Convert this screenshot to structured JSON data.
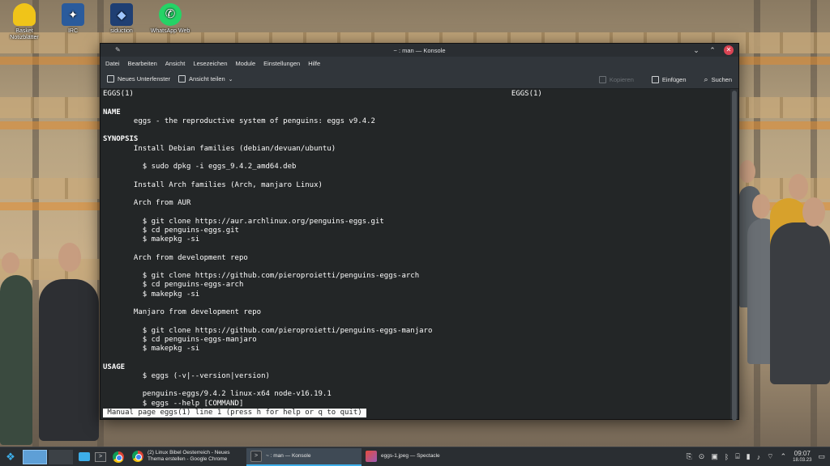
{
  "desktop": {
    "icons": [
      {
        "label": "Basket Notizblätter",
        "icon": "basket-icon"
      },
      {
        "label": "IRC",
        "icon": "irc-icon"
      },
      {
        "label": "siduction",
        "icon": "siduction-icon"
      },
      {
        "label": "WhatsApp Web",
        "icon": "whatsapp-icon"
      }
    ]
  },
  "window": {
    "title": "~ : man — Konsole",
    "menu": [
      "Datei",
      "Bearbeiten",
      "Ansicht",
      "Lesezeichen",
      "Module",
      "Einstellungen",
      "Hilfe"
    ],
    "toolbar": {
      "new_tab": "Neues Unterfenster",
      "split_view": "Ansicht teilen",
      "copy": "Kopieren",
      "paste": "Einfügen",
      "search": "Suchen"
    }
  },
  "terminal": {
    "lines": [
      {
        "text": "EGGS(1)                                                                                      EGGS(1)",
        "bold": false
      },
      {
        "text": "",
        "bold": false
      },
      {
        "text": "NAME",
        "bold": true
      },
      {
        "text": "       eggs - the reproductive system of penguins: eggs v9.4.2",
        "bold": false
      },
      {
        "text": "",
        "bold": false
      },
      {
        "text": "SYNOPSIS",
        "bold": true
      },
      {
        "text": "       Install Debian families (debian/devuan/ubuntu)",
        "bold": false
      },
      {
        "text": "",
        "bold": false
      },
      {
        "text": "         $ sudo dpkg -i eggs_9.4.2_amd64.deb",
        "bold": false
      },
      {
        "text": "",
        "bold": false
      },
      {
        "text": "       Install Arch families (Arch, manjaro Linux)",
        "bold": false
      },
      {
        "text": "",
        "bold": false
      },
      {
        "text": "       Arch from AUR",
        "bold": false
      },
      {
        "text": "",
        "bold": false
      },
      {
        "text": "         $ git clone https://aur.archlinux.org/penguins-eggs.git",
        "bold": false
      },
      {
        "text": "         $ cd penguins-eggs.git",
        "bold": false
      },
      {
        "text": "         $ makepkg -si",
        "bold": false
      },
      {
        "text": "",
        "bold": false
      },
      {
        "text": "       Arch from development repo",
        "bold": false
      },
      {
        "text": "",
        "bold": false
      },
      {
        "text": "         $ git clone https://github.com/pieroproietti/penguins-eggs-arch",
        "bold": false
      },
      {
        "text": "         $ cd penguins-eggs-arch",
        "bold": false
      },
      {
        "text": "         $ makepkg -si",
        "bold": false
      },
      {
        "text": "",
        "bold": false
      },
      {
        "text": "       Manjaro from development repo",
        "bold": false
      },
      {
        "text": "",
        "bold": false
      },
      {
        "text": "         $ git clone https://github.com/pieroproietti/penguins-eggs-manjaro",
        "bold": false
      },
      {
        "text": "         $ cd penguins-eggs-manjaro",
        "bold": false
      },
      {
        "text": "         $ makepkg -si",
        "bold": false
      },
      {
        "text": "",
        "bold": false
      },
      {
        "text": "USAGE",
        "bold": true
      },
      {
        "text": "         $ eggs (-v|--version|version)",
        "bold": false
      },
      {
        "text": "",
        "bold": false
      },
      {
        "text": "         penguins-eggs/9.4.2 linux-x64 node-v16.19.1",
        "bold": false
      },
      {
        "text": "         $ eggs --help [COMMAND]",
        "bold": false
      }
    ],
    "status": " Manual page eggs(1) line 1 (press h for help or q to quit) "
  },
  "taskbar": {
    "tasks": [
      {
        "label": "(2) Linux Bibel Oesterreich - Neues Thema erstellen - Google Chrome",
        "icon": "chrome-icon",
        "active": false
      },
      {
        "label": "~ : man — Konsole",
        "icon": "konsole-icon",
        "active": true
      },
      {
        "label": "eggs-1.jpeg — Spectacle",
        "icon": "spectacle-icon",
        "active": false
      }
    ],
    "clock": {
      "time": "09:07",
      "date": "18.03.23"
    }
  },
  "colors": {
    "accent": "#3daee9",
    "close": "#da4453",
    "terminal_bg": "#232627",
    "panel": "#2a2e32"
  }
}
